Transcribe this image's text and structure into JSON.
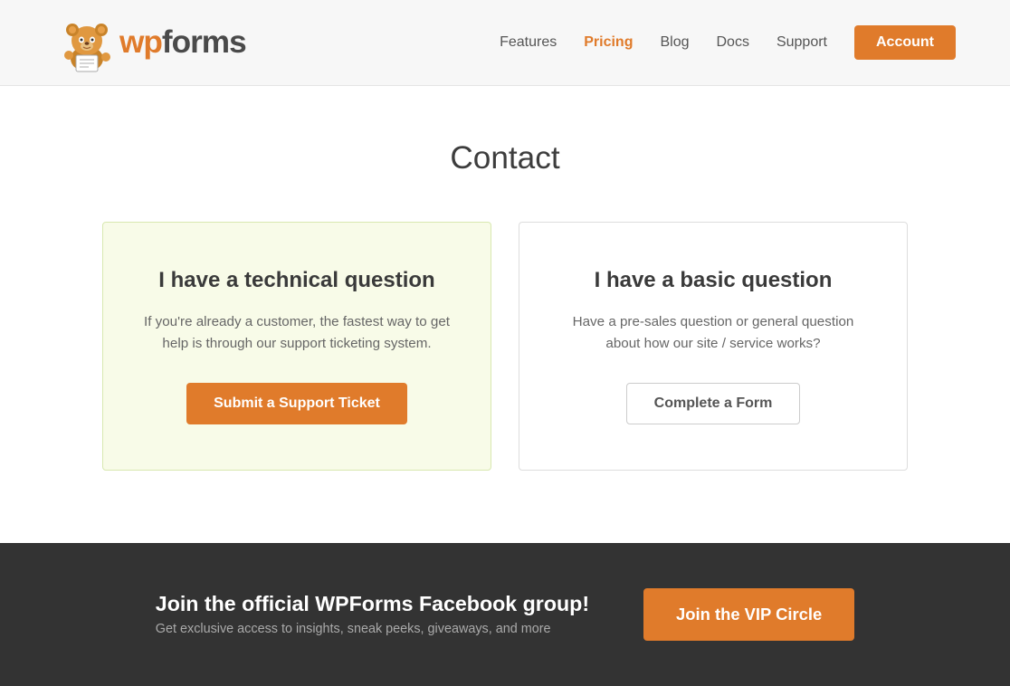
{
  "header": {
    "logo_text_wp": "wp",
    "logo_text_forms": "forms",
    "nav": [
      {
        "label": "Features",
        "active": false
      },
      {
        "label": "Pricing",
        "active": true
      },
      {
        "label": "Blog",
        "active": false
      },
      {
        "label": "Docs",
        "active": false
      },
      {
        "label": "Support",
        "active": false
      }
    ],
    "account_label": "Account"
  },
  "main": {
    "page_title": "Contact",
    "cards": [
      {
        "id": "technical",
        "heading": "I have a technical question",
        "description": "If you're already a customer, the fastest way to get help is through our support ticketing system.",
        "button_label": "Submit a Support Ticket",
        "type": "primary"
      },
      {
        "id": "basic",
        "heading": "I have a basic question",
        "description": "Have a pre-sales question or general question about how our site / service works?",
        "button_label": "Complete a Form",
        "type": "secondary"
      }
    ]
  },
  "footer_banner": {
    "heading": "Join the official WPForms Facebook group!",
    "subtext": "Get exclusive access to insights, sneak peeks, giveaways, and more",
    "button_label": "Join the VIP Circle"
  }
}
